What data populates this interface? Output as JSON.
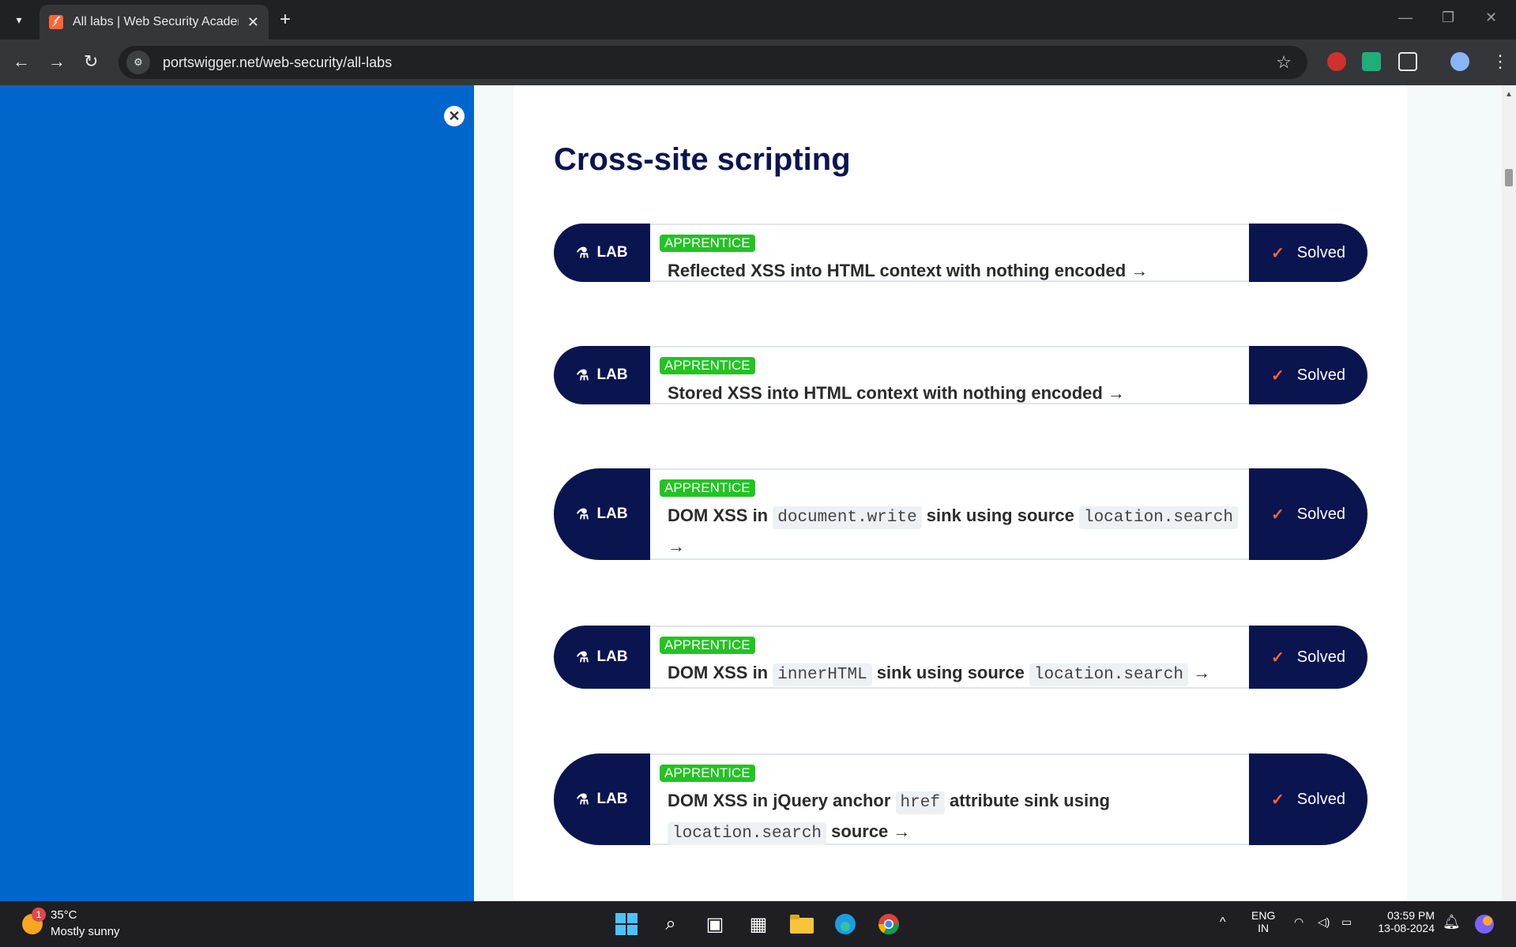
{
  "browser": {
    "tab_title": "All labs | Web Security Academy",
    "url": "portswigger.net/web-security/all-labs"
  },
  "page": {
    "section_title": "Cross-site scripting",
    "lab_label": "LAB",
    "solved_label": "Solved",
    "labs": [
      {
        "level": "APPRENTICE",
        "parts": [
          {
            "t": "text",
            "v": "Reflected XSS into HTML context with nothing encoded"
          }
        ]
      },
      {
        "level": "APPRENTICE",
        "parts": [
          {
            "t": "text",
            "v": "Stored XSS into HTML context with nothing encoded"
          }
        ]
      },
      {
        "level": "APPRENTICE",
        "parts": [
          {
            "t": "text",
            "v": "DOM XSS in "
          },
          {
            "t": "code",
            "v": "document.write"
          },
          {
            "t": "text",
            "v": " sink using source "
          },
          {
            "t": "code",
            "v": "location.search"
          }
        ]
      },
      {
        "level": "APPRENTICE",
        "parts": [
          {
            "t": "text",
            "v": "DOM XSS in "
          },
          {
            "t": "code",
            "v": "innerHTML"
          },
          {
            "t": "text",
            "v": " sink using source "
          },
          {
            "t": "code",
            "v": "location.search"
          }
        ]
      },
      {
        "level": "APPRENTICE",
        "parts": [
          {
            "t": "text",
            "v": "DOM XSS in jQuery anchor "
          },
          {
            "t": "code",
            "v": "href"
          },
          {
            "t": "text",
            "v": " attribute sink using "
          },
          {
            "t": "code",
            "v": "location.search"
          },
          {
            "t": "text",
            "v": " source"
          }
        ]
      }
    ]
  },
  "taskbar": {
    "weather_temp": "35°C",
    "weather_desc": "Mostly sunny",
    "weather_badge": "1",
    "lang_line1": "ENG",
    "lang_line2": "IN",
    "time": "03:59 PM",
    "date": "13-08-2024"
  },
  "colors": {
    "panel_blue": "#0066cc",
    "navy": "#0a1550",
    "badge_green": "#22c322",
    "check_orange": "#ff6633"
  }
}
